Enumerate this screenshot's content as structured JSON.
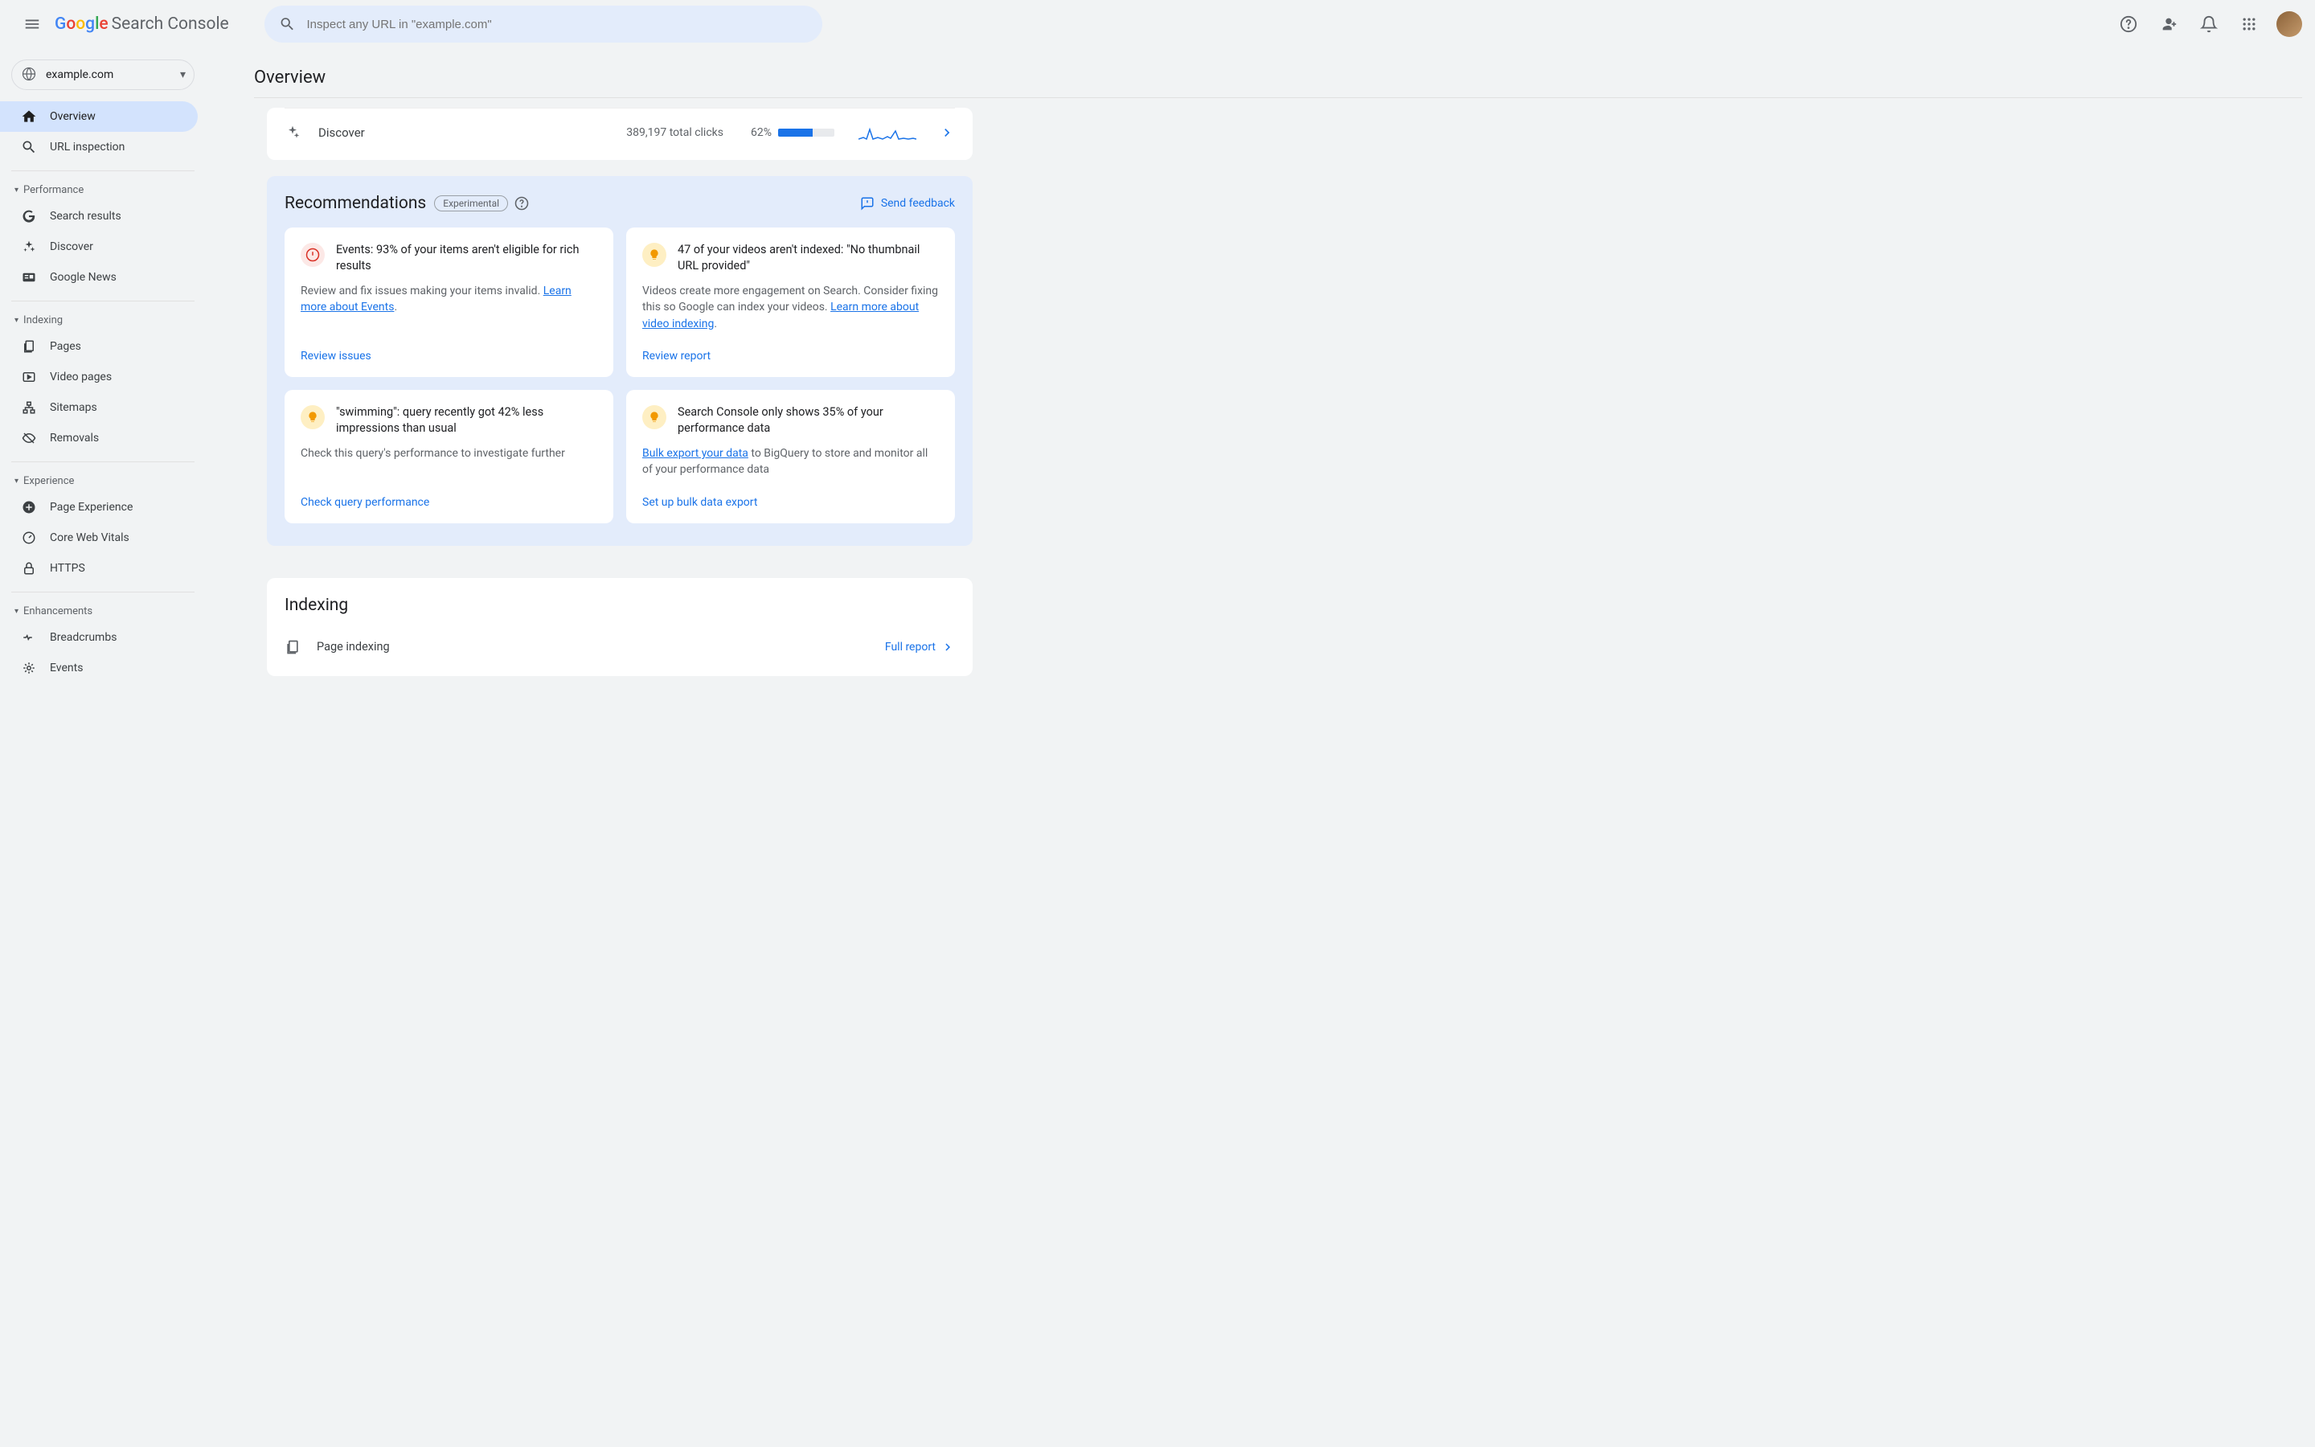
{
  "product_name": "Search Console",
  "search_placeholder": "Inspect any URL in \"example.com\"",
  "property": "example.com",
  "page_title": "Overview",
  "sidebar": {
    "items_top": [
      {
        "label": "Overview",
        "active": true
      },
      {
        "label": "URL inspection",
        "active": false
      }
    ],
    "groups": [
      {
        "label": "Performance",
        "items": [
          {
            "label": "Search results"
          },
          {
            "label": "Discover"
          },
          {
            "label": "Google News"
          }
        ]
      },
      {
        "label": "Indexing",
        "items": [
          {
            "label": "Pages"
          },
          {
            "label": "Video pages"
          },
          {
            "label": "Sitemaps"
          },
          {
            "label": "Removals"
          }
        ]
      },
      {
        "label": "Experience",
        "items": [
          {
            "label": "Page Experience"
          },
          {
            "label": "Core Web Vitals"
          },
          {
            "label": "HTTPS"
          }
        ]
      },
      {
        "label": "Enhancements",
        "items": [
          {
            "label": "Breadcrumbs"
          },
          {
            "label": "Events"
          }
        ]
      }
    ]
  },
  "discover": {
    "label": "Discover",
    "clicks": "389,197 total clicks",
    "pct_label": "62%",
    "pct_value": 62
  },
  "recommendations": {
    "title": "Recommendations",
    "badge": "Experimental",
    "feedback": "Send feedback",
    "cards": [
      {
        "icon": "err",
        "title": "Events: 93% of your items aren't eligible for rich results",
        "body_pre": "Review and fix issues making your items invalid. ",
        "link": "Learn more about Events",
        "body_post": ".",
        "action": "Review issues"
      },
      {
        "icon": "bulb",
        "title": "47 of your videos aren't indexed: \"No thumbnail URL provided\"",
        "body_pre": "Videos create more engagement on Search. Consider fixing this so Google can index your videos. ",
        "link": "Learn more about video indexing",
        "body_post": ".",
        "action": "Review report"
      },
      {
        "icon": "bulb",
        "title": "\"swimming\": query recently got 42% less impressions than usual",
        "body_pre": "Check this query's performance to investigate further",
        "link": "",
        "body_post": "",
        "action": "Check query performance"
      },
      {
        "icon": "bulb",
        "title": "Search Console only shows 35% of your performance data",
        "body_pre": "",
        "link": "Bulk export your data",
        "body_post": " to BigQuery to store and monitor all of your performance data",
        "action": "Set up bulk data export"
      }
    ]
  },
  "indexing": {
    "title": "Indexing",
    "row_label": "Page indexing",
    "full_report": "Full report"
  }
}
